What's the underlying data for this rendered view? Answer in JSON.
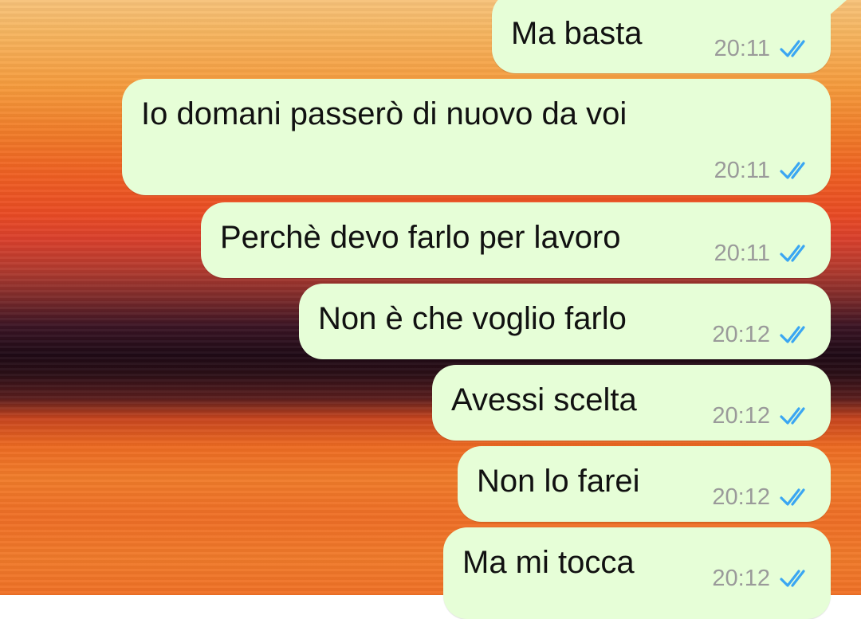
{
  "colors": {
    "bubble_background": "#e6fed7",
    "message_text": "#111111",
    "timestamp_text": "#9a9a9a",
    "read_ticks": "#3aa6f2"
  },
  "messages": [
    {
      "text": "Ma basta",
      "time": "20:11",
      "status": "read",
      "status_icon": "double-check-icon"
    },
    {
      "text": "Io domani passerò di nuovo da voi",
      "time": "20:11",
      "status": "read",
      "status_icon": "double-check-icon"
    },
    {
      "text": "Perchè devo farlo per lavoro",
      "time": "20:11",
      "status": "read",
      "status_icon": "double-check-icon"
    },
    {
      "text": "Non è che voglio farlo",
      "time": "20:12",
      "status": "read",
      "status_icon": "double-check-icon"
    },
    {
      "text": "Avessi scelta",
      "time": "20:12",
      "status": "read",
      "status_icon": "double-check-icon"
    },
    {
      "text": "Non lo farei",
      "time": "20:12",
      "status": "read",
      "status_icon": "double-check-icon"
    },
    {
      "text": "Ma mi tocca",
      "time": "20:12",
      "status": "read",
      "status_icon": "double-check-icon"
    }
  ]
}
